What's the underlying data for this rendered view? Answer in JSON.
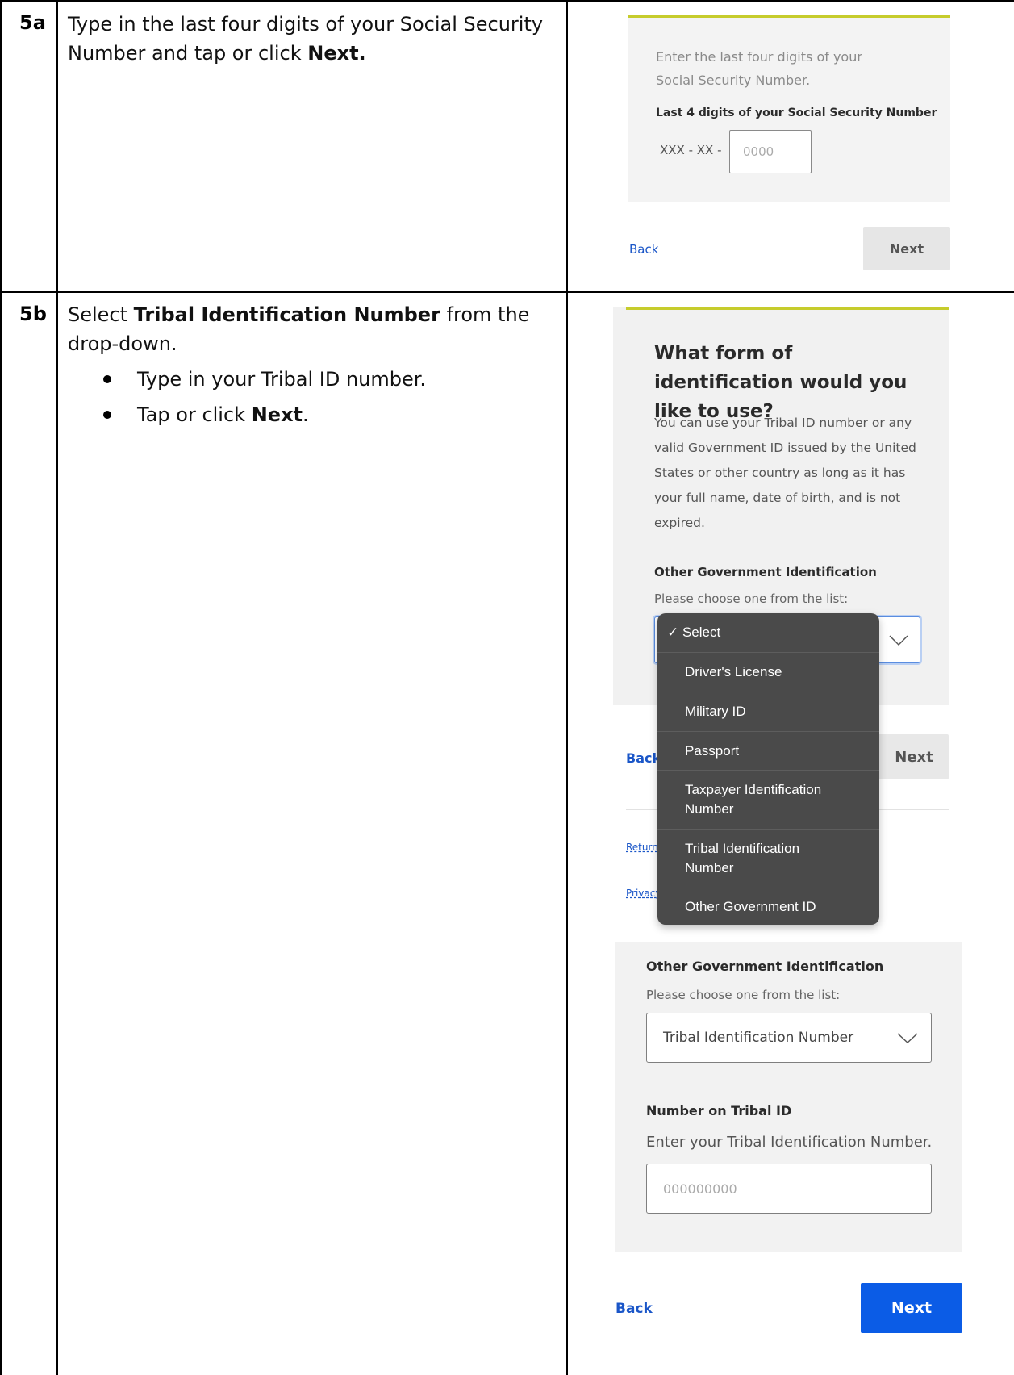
{
  "steps": [
    {
      "number": "5a",
      "instruction_parts": [
        "Type in the last four digits of your Social Security Number and tap or click ",
        "Next."
      ],
      "screen": {
        "intro": "Enter the last four digits of your Social Security Number.",
        "field_label": "Last 4 digits of your Social Security Number",
        "prefix": "XXX - XX -",
        "placeholder": "0000",
        "back": "Back",
        "next": "Next"
      }
    },
    {
      "number": "5b",
      "instruction_parts": [
        "Select ",
        "Tribal Identification Number",
        " from the drop-down."
      ],
      "bullets": [
        {
          "text": "Type in your Tribal ID number.",
          "bold": ""
        },
        {
          "text": "Tap or click ",
          "bold": "Next",
          "after": "."
        }
      ],
      "screen1": {
        "heading": "What form of identification would you like to use?",
        "body": "You can use your Tribal ID number or any valid Government ID issued by the United States or other country as long as it has your full name, date of birth, and is not expired.",
        "field_label": "Other Government Identification",
        "hint": "Please choose one from the list:",
        "back": "Back",
        "next": "Next",
        "footer_links": [
          "Return",
          "Privacy"
        ],
        "dropdown_options": [
          "✓ Select",
          "Driver's License",
          "Military ID",
          "Passport",
          "Taxpayer Identification Number",
          "Tribal Identification Number",
          "Other Government ID"
        ]
      },
      "screen2": {
        "field_label": "Other Government Identification",
        "hint": "Please choose one from the list:",
        "selected": "Tribal Identification Number",
        "number_label": "Number on Tribal ID",
        "number_hint": "Enter your Tribal Identification Number.",
        "number_placeholder": "000000000",
        "back": "Back",
        "next": "Next"
      }
    }
  ],
  "colors": {
    "accent": "#c6cc2c",
    "primary_button": "#0b5ce6",
    "link": "#1a56c8",
    "dropdown_bg": "#4a4a4a"
  }
}
